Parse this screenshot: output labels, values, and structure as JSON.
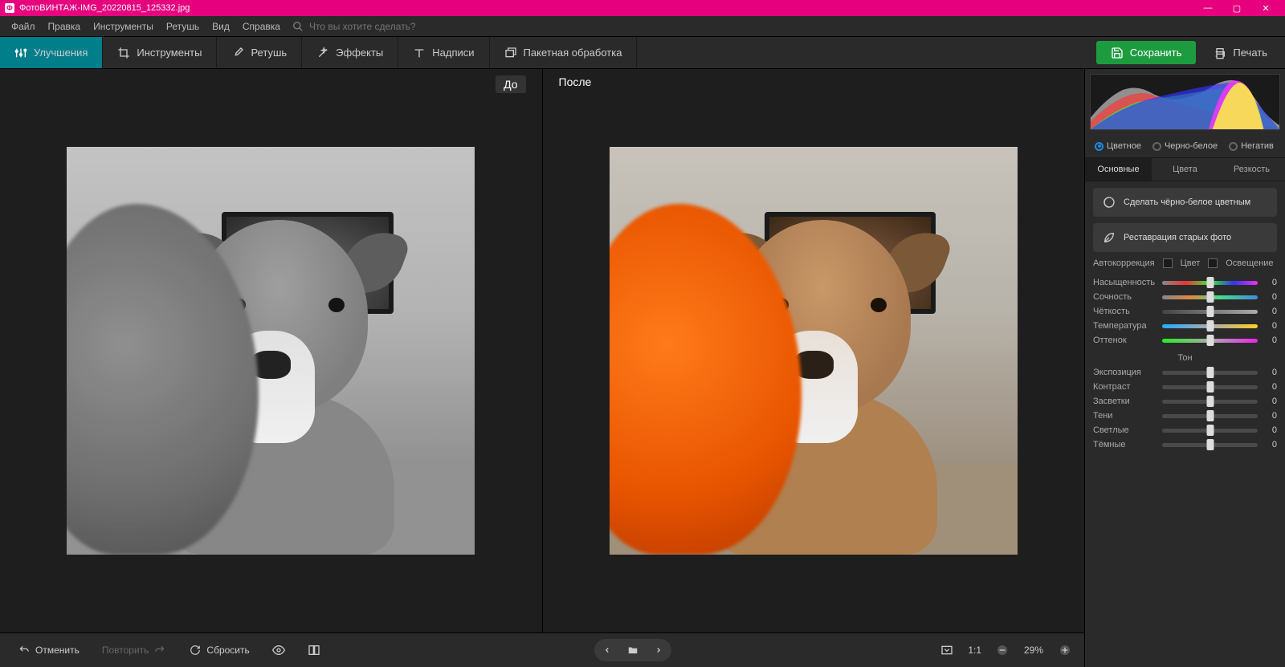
{
  "title": {
    "app": "ФотоВИНТАЖ",
    "sep": " - ",
    "file": "IMG_20220815_125332.jpg"
  },
  "window_controls": {
    "min": "—",
    "max": "▢",
    "close": "✕"
  },
  "menu": {
    "file": "Файл",
    "edit": "Правка",
    "tools": "Инструменты",
    "retouch": "Ретушь",
    "view": "Вид",
    "help": "Справка"
  },
  "menu_search": {
    "placeholder": "Что вы хотите сделать?"
  },
  "toolbar": {
    "enhance": "Улучшения",
    "tools": "Инструменты",
    "retouch": "Ретушь",
    "effects": "Эффекты",
    "captions": "Надписи",
    "batch": "Пакетная обработка",
    "save": "Сохранить",
    "print": "Печать"
  },
  "compare": {
    "before": "До",
    "after": "После"
  },
  "bottombar": {
    "undo": "Отменить",
    "redo": "Повторить",
    "reset": "Сбросить"
  },
  "zoom": {
    "oneToOne": "1:1",
    "percent": "29%"
  },
  "color_mode": {
    "color": "Цветное",
    "bw": "Черно-белое",
    "negative": "Негатив",
    "selected": "color"
  },
  "tabs": {
    "basic": "Основные",
    "colors": "Цвета",
    "sharpness": "Резкость",
    "active": "basic"
  },
  "actions": {
    "make_color": "Сделать чёрно-белое цветным",
    "restore_old": "Реставрация старых фото"
  },
  "autocorr": {
    "label": "Автокоррекция",
    "color": "Цвет",
    "lighting": "Освещение"
  },
  "sliders_main": [
    {
      "name": "saturation",
      "label": "Насыщенность",
      "track": "track-sat",
      "value": 0
    },
    {
      "name": "vibrance",
      "label": "Сочность",
      "track": "track-vib",
      "value": 0
    },
    {
      "name": "clarity",
      "label": "Чёткость",
      "track": "track-def",
      "value": 0
    },
    {
      "name": "temperature",
      "label": "Температура",
      "track": "track-temp",
      "value": 0
    },
    {
      "name": "tint",
      "label": "Оттенок",
      "track": "track-tint",
      "value": 0
    }
  ],
  "tone_header": "Тон",
  "sliders_tone": [
    {
      "name": "exposure",
      "label": "Экспозиция",
      "track": "track-gray",
      "value": 0
    },
    {
      "name": "contrast",
      "label": "Контраст",
      "track": "track-gray",
      "value": 0
    },
    {
      "name": "highlights",
      "label": "Засветки",
      "track": "track-gray",
      "value": 0
    },
    {
      "name": "shadows",
      "label": "Тени",
      "track": "track-gray",
      "value": 0
    },
    {
      "name": "whites",
      "label": "Светлые",
      "track": "track-gray",
      "value": 0
    },
    {
      "name": "blacks",
      "label": "Тёмные",
      "track": "track-gray",
      "value": 0
    }
  ]
}
